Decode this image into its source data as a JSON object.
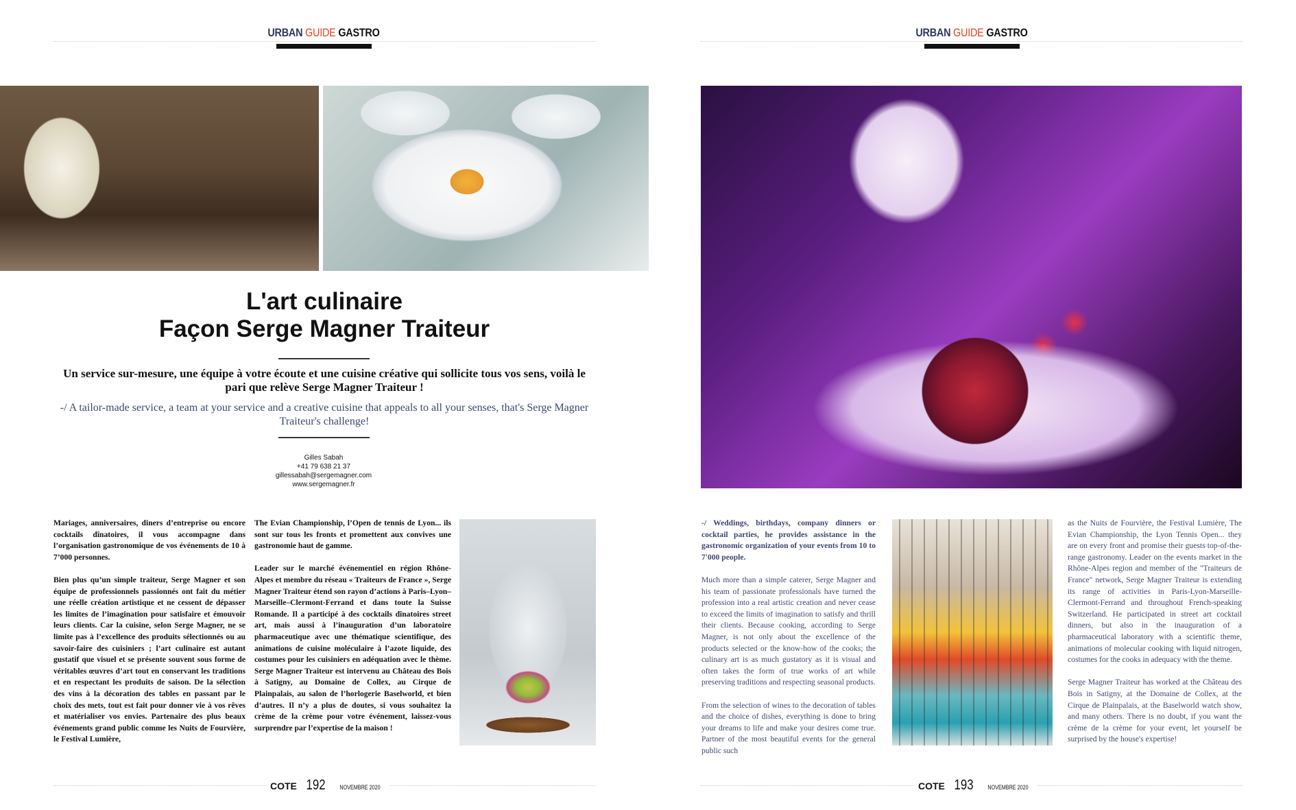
{
  "header": {
    "urban": "URBAN",
    "guide": "GUIDE",
    "gastro": "GASTRO"
  },
  "left": {
    "title_line1": "L'art culinaire",
    "title_line2": "Façon Serge Magner Traiteur",
    "intro_fr": "Un service sur-mesure, une équipe à votre écoute et une cuisine créative qui sollicite tous vos sens, voilà le pari que relève Serge Magner Traiteur !",
    "intro_en": "-/ A tailor-made service, a team at your service and a creative cuisine that appeals to all your senses, that's Serge Magner Traiteur's challenge!",
    "contact": {
      "name": "Gilles Sabah",
      "phone": "+41 79 638 21 37",
      "email": "gillessabah@sergemagner.com",
      "web": "www.sergemagner.fr"
    },
    "col1": [
      "Mariages, anniversaires, diners d’entreprise ou encore cocktails dînatoires, il vous accompagne dans l’organisation gastronomique de vos événements de 10 à 7’000 personnes.",
      "Bien plus qu’un simple traiteur, Serge Magner et son équipe de professionnels passionnés ont fait du métier une réelle création artistique et ne cessent de dépasser les limites de l’imagination pour satisfaire et émouvoir leurs clients. Car la cuisine, selon Serge Magner, ne se limite pas à l’excellence des produits sélectionnés ou au savoir-faire des cuisiniers ; l’art culinaire est autant gustatif que visuel et se présente souvent sous forme de véritables œuvres d’art tout en conservant les traditions et en respectant les produits de saison. De la sélection des vins à la décoration des tables en passant par le choix des mets, tout est fait pour donner vie à vos rêves et matérialiser vos envies. Partenaire des plus beaux événements grand public comme les Nuits de Fourvière, le Festival Lumière,"
    ],
    "col2": [
      "The Evian Championship, l’Open de tennis de Lyon... ils sont sur tous les fronts et promettent aux convives une gastronomie haut de gamme.",
      "Leader sur le marché événementiel en région Rhône-Alpes et membre du réseau « Traiteurs de France », Serge Magner Traiteur étend son rayon d’actions à Paris–Lyon–Marseille–Clermont-Ferrand et dans toute la Suisse Romande. Il a participé à des cocktails dînatoires street art, mais aussi à l’inauguration d’un laboratoire pharmaceutique avec une thématique scientifique, des animations de cuisine moléculaire à l’azote liquide, des costumes pour les cuisiniers en adéquation avec le thème. Serge Magner Traiteur est intervenu au Château des Bois à Satigny, au Domaine de Collex, au Cirque de Plainpalais, au salon de l’horlogerie Baselworld, et bien d’autres. Il n’y a plus de doutes, si vous souhaitez la crème de la crème pour votre événement, laissez-vous surprendre par l’expertise de la maison !"
    ],
    "footer": {
      "brand": "COTE",
      "page": "192",
      "month": "NOVEMBRE 2020"
    }
  },
  "right": {
    "col1": [
      "-/ Weddings, birthdays, company dinners or cocktail parties, he provides assistance in the gastronomic organization of your events from 10 to 7'000 people.",
      "Much more than a simple caterer, Serge Magner and his team of passionate professionals have turned the profession into a real artistic creation and never cease to exceed the limits of imagination to satisfy and thrill their clients. Because cooking, according to Serge Magner, is not only about the excellence of the products selected or the know-how of the cooks; the culinary art is as much gustatory as it is visual and often takes the form of true works of art while preserving traditions and respecting seasonal products.",
      "From the selection of wines to the decoration of tables and the choice of dishes, everything is done to bring your dreams to life and make your desires come true. Partner of the most beautiful events for the general public such"
    ],
    "col2": [
      "as the Nuits de Fourvière, the Festival Lumière, The Evian Championship, the Lyon Tennis Open... they are on every front and promise their guests top-of-the-range gastronomy. Leader on the events market in the Rhône-Alpes region and member of the \"Traiteurs de France\" network, Serge Magner Traiteur is extending its range of activities in Paris-Lyon-Marseille-Clermont-Ferrand and throughout French-speaking Switzerland. He participated in street art cocktail dinners, but also in the inauguration of a pharmaceutical laboratory with a scientific theme, animations of molecular cooking with liquid nitrogen, costumes for the cooks in adequacy with the theme.",
      "Serge Magner Traiteur has worked at the Château des Bois in Satigny, at the Domaine de Collex, at the Cirque de Plainpalais, at the Baselworld watch show, and many others. There is no doubt, if you want the crème de la crème for your event, let yourself be surprised by the house's expertise!"
    ],
    "footer": {
      "brand": "COTE",
      "page": "193",
      "month": "NOVEMBRE 2020"
    }
  }
}
